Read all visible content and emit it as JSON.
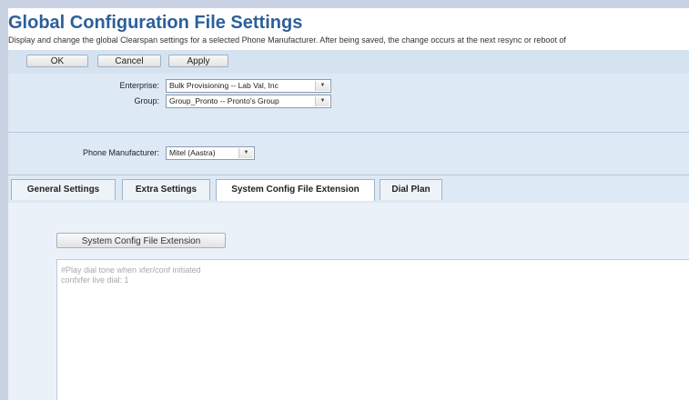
{
  "header": {
    "title": "Global Configuration File Settings",
    "description": "Display and change the global Clearspan settings for a selected Phone Manufacturer. After being saved, the change occurs at the next resync or reboot of"
  },
  "actions": {
    "ok": "OK",
    "cancel": "Cancel",
    "apply": "Apply"
  },
  "form": {
    "enterprise_label": "Enterprise:",
    "enterprise_value": "Bulk Provisioning -- Lab Val, Inc",
    "group_label": "Group:",
    "group_value": "Group_Pronto -- Pronto's Group",
    "manufacturer_label": "Phone Manufacturer:",
    "manufacturer_value": "Mitel (Aastra)"
  },
  "tabs": [
    {
      "label": "General Settings",
      "active": false
    },
    {
      "label": "Extra Settings",
      "active": false
    },
    {
      "label": "System Config File Extension",
      "active": true
    },
    {
      "label": "Dial Plan",
      "active": false
    }
  ],
  "content": {
    "button_label": "System Config File Extension",
    "text_lines": [
      "#Play dial tone when xfer/conf initiated",
      "confxfer live dial: 1"
    ]
  },
  "colors": {
    "title": "#2c5f9a",
    "panel": "#dde9f4",
    "frame": "#c9d2e3"
  }
}
